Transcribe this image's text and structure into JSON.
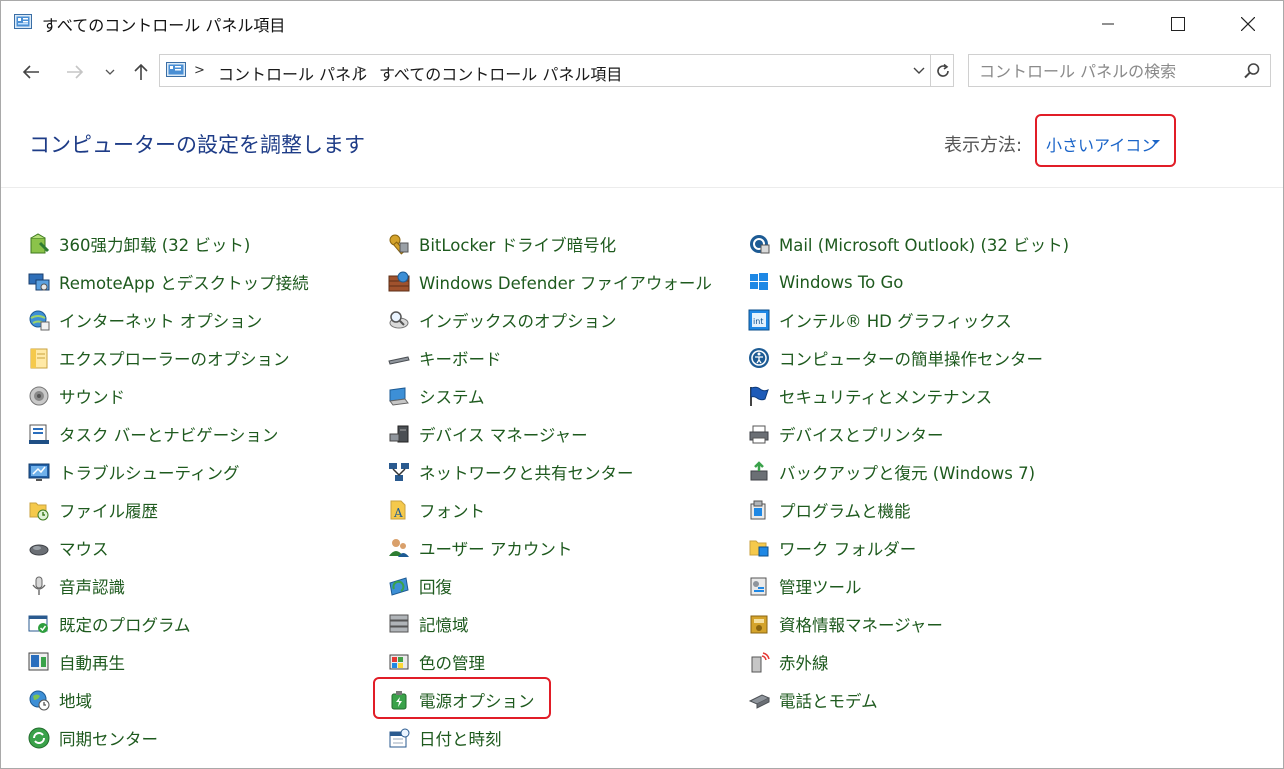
{
  "window": {
    "title": "すべてのコントロール パネル項目",
    "controls": [
      "minimize",
      "maximize",
      "close"
    ]
  },
  "nav": {
    "breadcrumb": [
      "コントロール パネル",
      "すべてのコントロール パネル項目"
    ],
    "search_placeholder": "コントロール パネルの検索"
  },
  "header": {
    "title": "コンピューターの設定を調整します",
    "view_label": "表示方法:",
    "view_value": "小さいアイコン"
  },
  "columns": [
    [
      {
        "label": "360强力卸载 (32 ビット)",
        "icon": "uninstaller-icon"
      },
      {
        "label": "RemoteApp とデスクトップ接続",
        "icon": "remoteapp-icon"
      },
      {
        "label": "インターネット オプション",
        "icon": "internet-options-icon"
      },
      {
        "label": "エクスプローラーのオプション",
        "icon": "folder-options-icon"
      },
      {
        "label": "サウンド",
        "icon": "sound-icon"
      },
      {
        "label": "タスク バーとナビゲーション",
        "icon": "taskbar-icon"
      },
      {
        "label": "トラブルシューティング",
        "icon": "troubleshooting-icon"
      },
      {
        "label": "ファイル履歴",
        "icon": "file-history-icon"
      },
      {
        "label": "マウス",
        "icon": "mouse-icon"
      },
      {
        "label": "音声認識",
        "icon": "microphone-icon"
      },
      {
        "label": "既定のプログラム",
        "icon": "default-programs-icon"
      },
      {
        "label": "自動再生",
        "icon": "autoplay-icon"
      },
      {
        "label": "地域",
        "icon": "region-icon"
      },
      {
        "label": "同期センター",
        "icon": "sync-center-icon"
      }
    ],
    [
      {
        "label": "BitLocker ドライブ暗号化",
        "icon": "bitlocker-icon"
      },
      {
        "label": "Windows Defender ファイアウォール",
        "icon": "firewall-icon"
      },
      {
        "label": "インデックスのオプション",
        "icon": "indexing-icon"
      },
      {
        "label": "キーボード",
        "icon": "keyboard-icon"
      },
      {
        "label": "システム",
        "icon": "system-icon"
      },
      {
        "label": "デバイス マネージャー",
        "icon": "device-manager-icon"
      },
      {
        "label": "ネットワークと共有センター",
        "icon": "network-icon"
      },
      {
        "label": "フォント",
        "icon": "fonts-icon"
      },
      {
        "label": "ユーザー アカウント",
        "icon": "user-accounts-icon"
      },
      {
        "label": "回復",
        "icon": "recovery-icon"
      },
      {
        "label": "記憶域",
        "icon": "storage-icon"
      },
      {
        "label": "色の管理",
        "icon": "color-management-icon"
      },
      {
        "label": "電源オプション",
        "icon": "power-options-icon"
      },
      {
        "label": "日付と時刻",
        "icon": "date-time-icon"
      }
    ],
    [
      {
        "label": "Mail (Microsoft Outlook) (32 ビット)",
        "icon": "mail-icon"
      },
      {
        "label": "Windows To Go",
        "icon": "windows-to-go-icon"
      },
      {
        "label": "インテル® HD グラフィックス",
        "icon": "intel-graphics-icon"
      },
      {
        "label": "コンピューターの簡単操作センター",
        "icon": "ease-of-access-icon"
      },
      {
        "label": "セキュリティとメンテナンス",
        "icon": "security-flag-icon"
      },
      {
        "label": "デバイスとプリンター",
        "icon": "printer-icon"
      },
      {
        "label": "バックアップと復元 (Windows 7)",
        "icon": "backup-icon"
      },
      {
        "label": "プログラムと機能",
        "icon": "programs-features-icon"
      },
      {
        "label": "ワーク フォルダー",
        "icon": "work-folders-icon"
      },
      {
        "label": "管理ツール",
        "icon": "admin-tools-icon"
      },
      {
        "label": "資格情報マネージャー",
        "icon": "credential-manager-icon"
      },
      {
        "label": "赤外線",
        "icon": "infrared-icon"
      },
      {
        "label": "電話とモデム",
        "icon": "phone-modem-icon"
      }
    ]
  ],
  "colors": {
    "title_blue": "#1e3c87",
    "link_green": "#1e5a1e",
    "view_blue": "#1a64c8",
    "highlight_red": "#e11d27"
  }
}
